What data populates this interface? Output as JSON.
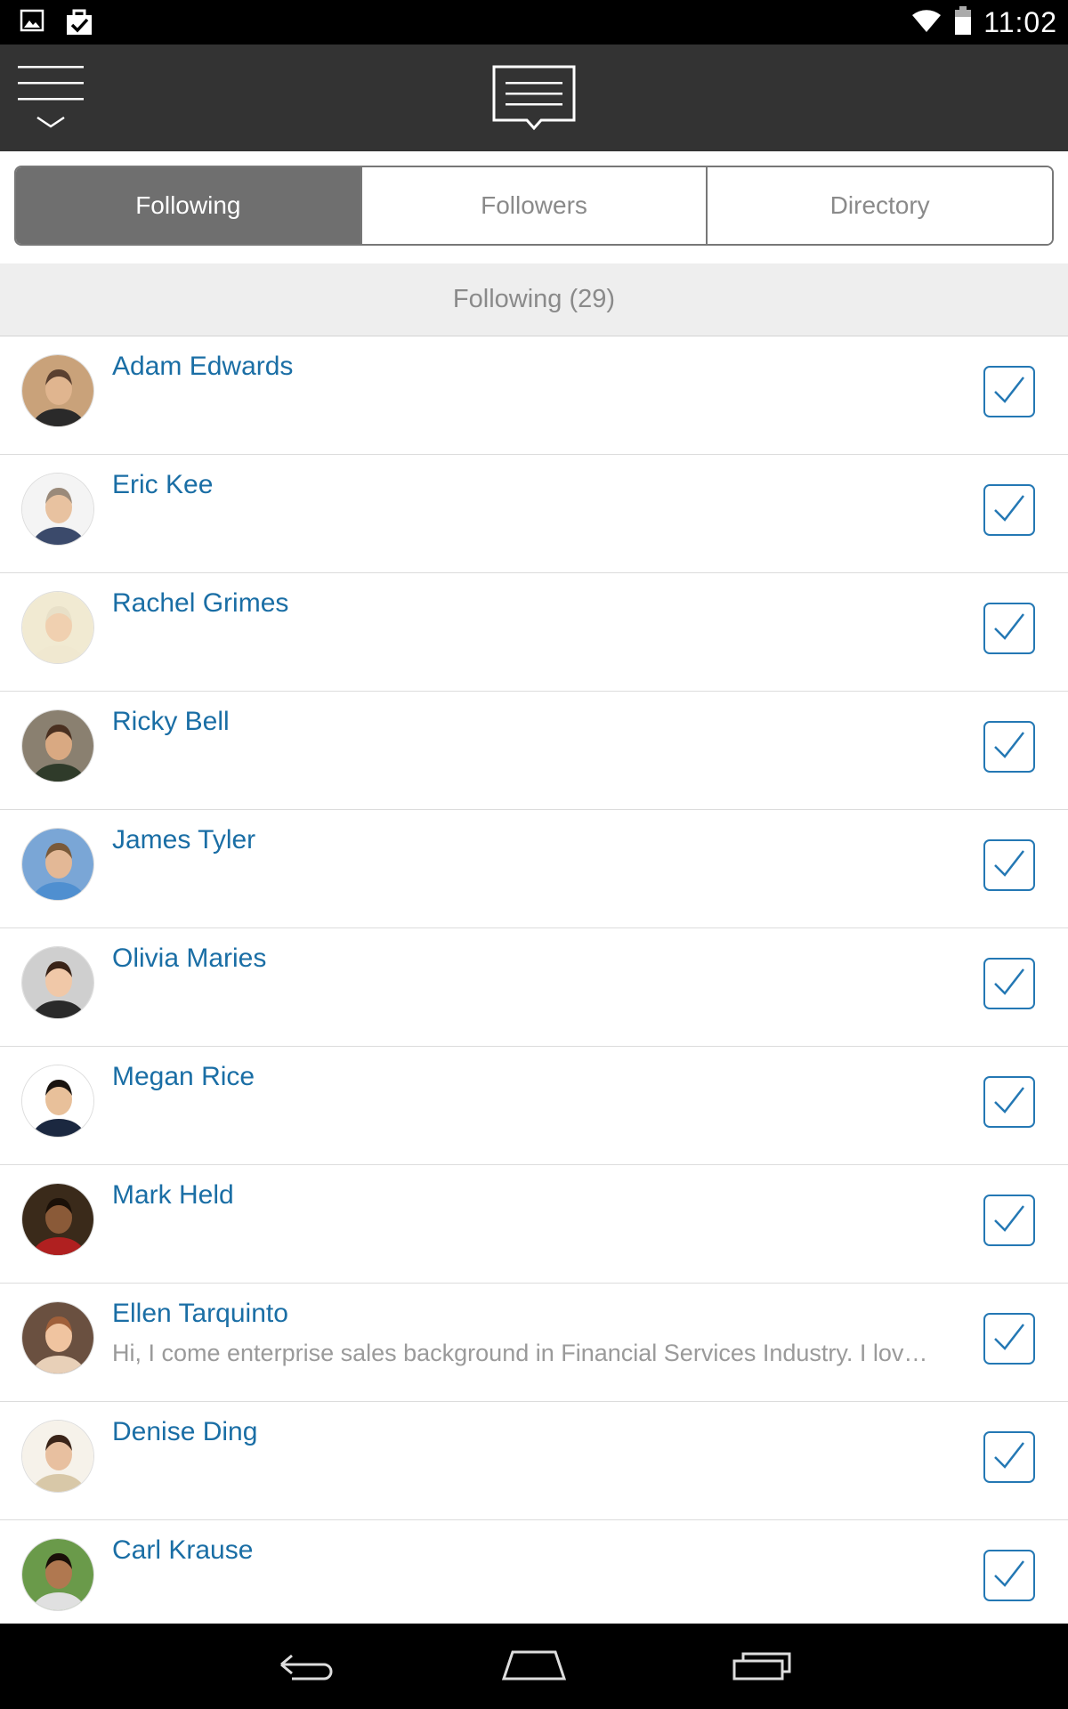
{
  "status_bar": {
    "time": "11:02",
    "icons": [
      "image-icon",
      "clipboard-check-icon",
      "wifi-icon",
      "battery-icon"
    ]
  },
  "app_bar": {
    "menu_icon": "menu-icon",
    "compose_icon": "message-icon"
  },
  "tabs": [
    {
      "label": "Following",
      "active": true
    },
    {
      "label": "Followers",
      "active": false
    },
    {
      "label": "Directory",
      "active": false
    }
  ],
  "section": {
    "title": "Following (29)"
  },
  "people": [
    {
      "name": "Adam Edwards",
      "subtitle": "",
      "following": true
    },
    {
      "name": "Eric Kee",
      "subtitle": "",
      "following": true
    },
    {
      "name": "Rachel Grimes",
      "subtitle": "",
      "following": true
    },
    {
      "name": "Ricky Bell",
      "subtitle": "",
      "following": true
    },
    {
      "name": "James Tyler",
      "subtitle": "",
      "following": true
    },
    {
      "name": "Olivia Maries",
      "subtitle": "",
      "following": true
    },
    {
      "name": "Megan Rice",
      "subtitle": "",
      "following": true
    },
    {
      "name": "Mark Held",
      "subtitle": "",
      "following": true
    },
    {
      "name": "Ellen Tarquinto",
      "subtitle": "Hi, I come enterprise sales background in Financial Services Industry. I lov…",
      "following": true
    },
    {
      "name": "Denise Ding",
      "subtitle": "",
      "following": true
    },
    {
      "name": "Carl Krause",
      "subtitle": "",
      "following": true
    }
  ],
  "nav_bar": {
    "back_icon": "back-icon",
    "home_icon": "home-icon",
    "recents_icon": "recent-apps-icon"
  },
  "colors": {
    "app_bar": "#333333",
    "name_link": "#1a6ea5",
    "check_border": "#2478b4",
    "active_tab": "#6f6f6f"
  }
}
